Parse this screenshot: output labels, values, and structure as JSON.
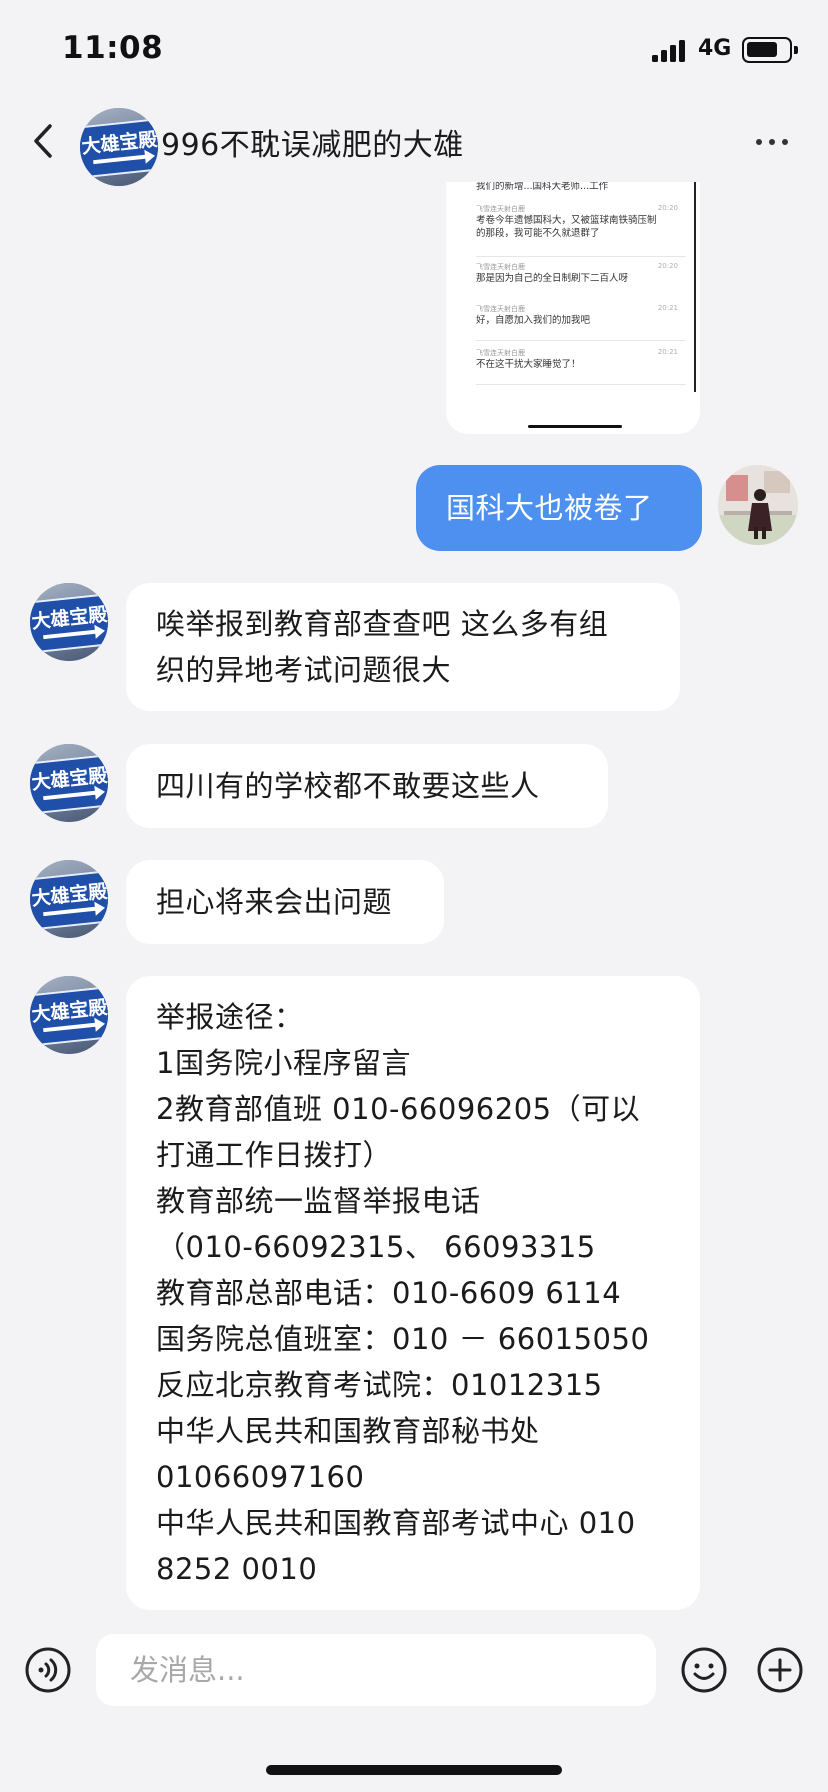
{
  "status_bar": {
    "time": "11:08",
    "network": "4G"
  },
  "header": {
    "title": "996不耽误减肥的大雄",
    "avatar_sign_text": "大雄宝殿"
  },
  "colors": {
    "accent": "#4e90f0",
    "background": "#f3f3f6",
    "incoming_bubble": "#ffffff",
    "avatar_sign_blue": "#1f4fa8"
  },
  "shared_image": {
    "rows": [
      {
        "name": "",
        "time": "",
        "text": "我们的新增...国科大老师...工作"
      },
      {
        "name": "飞雪连天射白鹿",
        "time": "20:20",
        "text": "考卷今年遗憾国科大，又被篮球南铁骑压制",
        "text2": "的那段，我可能不久就退群了"
      },
      {
        "name": "飞雪连天射白鹿",
        "time": "20:20",
        "text": "那是因为自己的全日制刷下二百人呀"
      },
      {
        "name": "飞雪连天射白鹿",
        "time": "20:21",
        "text": "好，自愿加入我们的加我吧"
      },
      {
        "name": "飞雪连天射白鹿",
        "time": "20:21",
        "text": "不在这干扰大家睡觉了！"
      }
    ]
  },
  "messages": [
    {
      "from": "me",
      "lines": [
        "国科大也被卷了"
      ]
    },
    {
      "from": "other",
      "lines": [
        "唉举报到教育部查查吧 这么多有组",
        "织的异地考试问题很大"
      ]
    },
    {
      "from": "other",
      "lines": [
        "四川有的学校都不敢要这些人"
      ]
    },
    {
      "from": "other",
      "lines": [
        "担心将来会出问题"
      ]
    },
    {
      "from": "other",
      "lines": [
        "举报途径：",
        "1国务院小程序留言",
        "2教育部值班 010-66096205（可以",
        "打通工作日拨打）",
        "教育部统一监督举报电话",
        "（010-66092315、 66093315",
        "教育部总部电话：010-6609 6114",
        "国务院总值班室：010 － 66015050",
        "反应北京教育考试院：01012315",
        "中华人民共和国教育部秘书处",
        "01066097160",
        "中华人民共和国教育部考试中心 010",
        "8252 0010"
      ]
    }
  ],
  "input_bar": {
    "placeholder": "发消息..."
  },
  "icons": {
    "back": "back-chevron-icon",
    "more": "more-dots-icon",
    "voice": "voice-icon",
    "emoji": "emoji-icon",
    "add": "add-icon"
  }
}
